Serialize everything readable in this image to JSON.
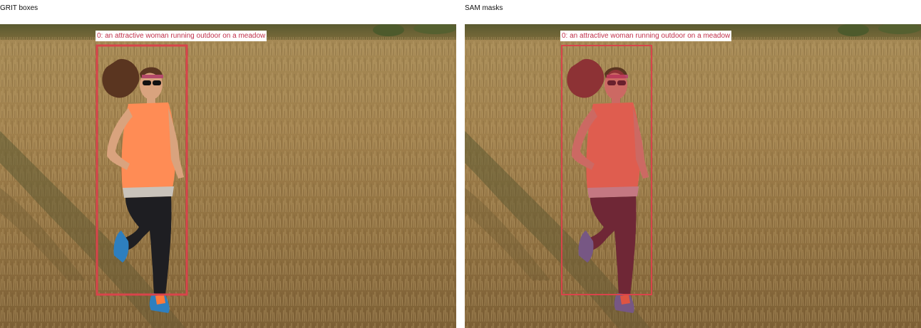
{
  "panels": [
    {
      "title": "GRIT boxes"
    },
    {
      "title": "SAM masks"
    }
  ],
  "detections": [
    {
      "label": "0: an attractive woman running outdoor on a meadow"
    }
  ],
  "colors": {
    "box": "#d9444b",
    "label_text": "#c0304a",
    "mask": "#c0304a"
  }
}
